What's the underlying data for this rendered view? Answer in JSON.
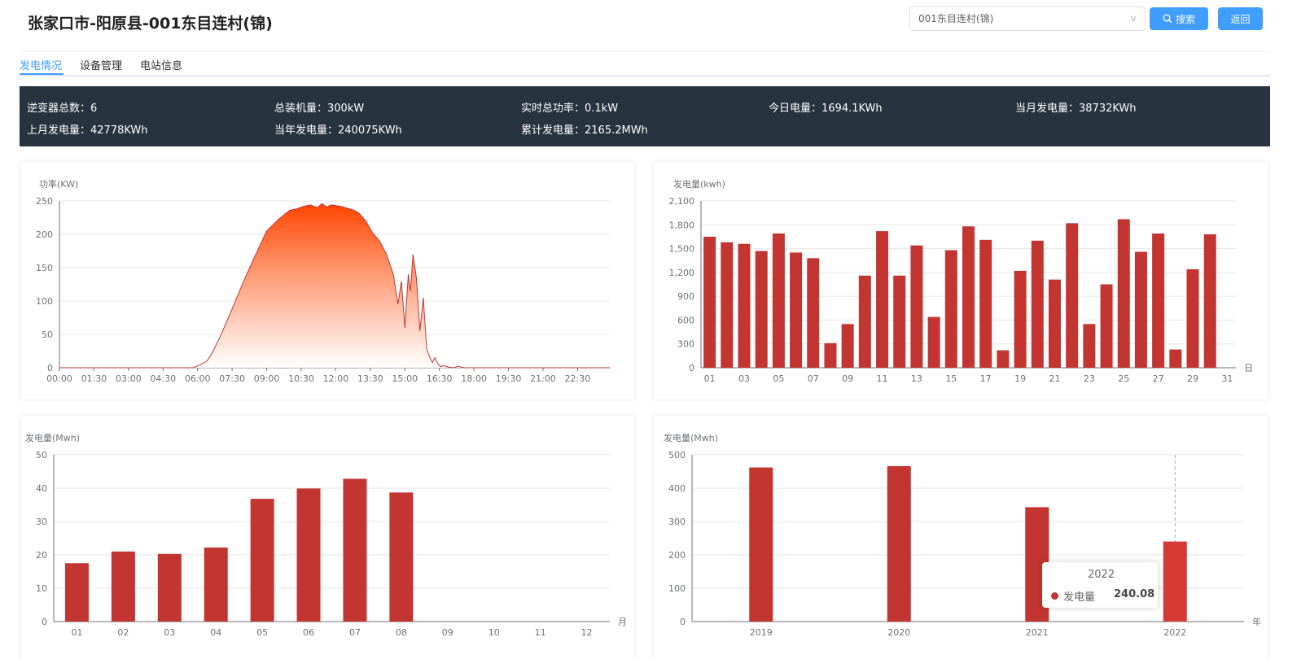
{
  "header": {
    "title": "张家口市-阳原县-001东目连村(锦)",
    "station_select": {
      "value": "001东目连村(锦)"
    },
    "search_label": "搜索",
    "back_label": "返回"
  },
  "tabs": [
    {
      "label": "发电情况",
      "active": true
    },
    {
      "label": "设备管理",
      "active": false
    },
    {
      "label": "电站信息",
      "active": false
    }
  ],
  "stats": {
    "inverter_count": "逆变器总数：6",
    "installed_capacity": "总装机量：300kW",
    "realtime_power": "实时总功率：0.1kW",
    "today_energy": "今日电量：1694.1KWh",
    "month_energy": "当月发电量：38732KWh",
    "last_month_energy": "上月发电量：42778KWh",
    "year_energy": "当年发电量：240075KWh",
    "total_energy": "累计发电量：2165.2MWh"
  },
  "colors": {
    "accent": "#409eff",
    "bar": "#c23531",
    "area_top": "#ff4500",
    "stats_bg": "#27343f"
  },
  "chart_data": [
    {
      "type": "area",
      "ylabel": "功率(KW)",
      "ylim": [
        0,
        250
      ],
      "yticks": [
        "0",
        "50",
        "100",
        "150",
        "200",
        "250"
      ],
      "xticks": [
        "00:00",
        "01:30",
        "03:00",
        "04:30",
        "06:00",
        "07:30",
        "09:00",
        "10:30",
        "12:00",
        "13:30",
        "15:00",
        "16:30",
        "18:00",
        "19:30",
        "21:00",
        "22:30"
      ],
      "x_hours": [
        0,
        5.8,
        6.1,
        6.4,
        6.6,
        7.0,
        7.5,
        8.0,
        8.5,
        9.0,
        9.5,
        10.0,
        10.3,
        10.6,
        10.9,
        11.2,
        11.4,
        11.6,
        11.8,
        12.0,
        12.2,
        12.5,
        12.8,
        13.0,
        13.3,
        13.6,
        13.9,
        14.2,
        14.5,
        14.7,
        14.85,
        15.0,
        15.15,
        15.25,
        15.35,
        15.5,
        15.65,
        15.8,
        15.95,
        16.1,
        16.2,
        16.3,
        16.45,
        16.55,
        16.7,
        16.9,
        17.1,
        17.3,
        17.6,
        18.0,
        18.4,
        23.9
      ],
      "values": [
        0,
        0,
        4,
        10,
        20,
        48,
        88,
        130,
        168,
        205,
        222,
        236,
        238,
        242,
        244,
        240,
        246,
        241,
        244,
        243,
        242,
        239,
        236,
        232,
        220,
        202,
        190,
        170,
        140,
        95,
        130,
        60,
        140,
        115,
        170,
        135,
        55,
        105,
        28,
        14,
        8,
        15,
        5,
        2,
        3,
        1,
        0,
        2,
        0,
        0,
        0,
        0
      ]
    },
    {
      "type": "bar",
      "ylabel": "发电量(kwh)",
      "xunit": "日",
      "ylim": [
        0,
        2100
      ],
      "yticks": [
        "0",
        "300",
        "600",
        "900",
        "1,200",
        "1,500",
        "1,800",
        "2,100"
      ],
      "categories": [
        "01",
        "02",
        "03",
        "04",
        "05",
        "06",
        "07",
        "08",
        "09",
        "10",
        "11",
        "12",
        "13",
        "14",
        "15",
        "16",
        "17",
        "18",
        "19",
        "20",
        "21",
        "22",
        "23",
        "24",
        "25",
        "26",
        "27",
        "28",
        "29",
        "30",
        "31"
      ],
      "xtick_labels": [
        "01",
        "",
        "03",
        "",
        "05",
        "",
        "07",
        "",
        "09",
        "",
        "11",
        "",
        "13",
        "",
        "15",
        "",
        "17",
        "",
        "19",
        "",
        "21",
        "",
        "23",
        "",
        "25",
        "",
        "27",
        "",
        "29",
        "",
        "31"
      ],
      "values": [
        1650,
        1580,
        1560,
        1470,
        1690,
        1450,
        1380,
        310,
        550,
        1160,
        1720,
        1160,
        1540,
        640,
        1480,
        1780,
        1610,
        220,
        1220,
        1600,
        1110,
        1820,
        550,
        1050,
        1870,
        1460,
        1690,
        230,
        1240,
        1680,
        null
      ]
    },
    {
      "type": "bar",
      "ylabel": "发电量(Mwh)",
      "xunit": "月",
      "ylim": [
        0,
        50
      ],
      "yticks": [
        "0",
        "10",
        "20",
        "30",
        "40",
        "50"
      ],
      "categories": [
        "01",
        "02",
        "03",
        "04",
        "05",
        "06",
        "07",
        "08",
        "09",
        "10",
        "11",
        "12"
      ],
      "values": [
        17.5,
        21,
        20.3,
        22.2,
        36.8,
        39.9,
        42.8,
        38.7,
        null,
        null,
        null,
        null
      ]
    },
    {
      "type": "bar",
      "ylabel": "发电量(Mwh)",
      "xunit": "年",
      "ylim": [
        0,
        500
      ],
      "yticks": [
        "0",
        "100",
        "200",
        "300",
        "400",
        "500"
      ],
      "categories": [
        "2019",
        "2020",
        "2021",
        "2022"
      ],
      "values": [
        462,
        466,
        343,
        240.08
      ],
      "series_name": "发电量",
      "tooltip": {
        "title": "2022",
        "name": "发电量",
        "value": "240.08"
      }
    }
  ]
}
